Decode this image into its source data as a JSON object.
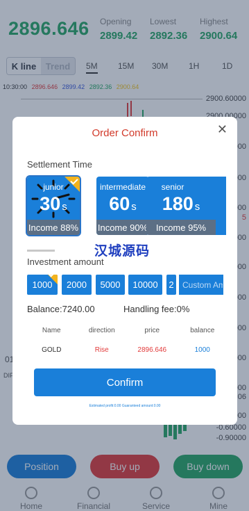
{
  "market": {
    "last_price": "2896.646",
    "stats": [
      {
        "label": "Opening",
        "value": "2899.42"
      },
      {
        "label": "Lowest",
        "value": "2892.36"
      },
      {
        "label": "Highest",
        "value": "2900.64"
      }
    ]
  },
  "chart_toolbar": {
    "kline_label": "K line",
    "trend_label": "Trend",
    "intervals": [
      "5M",
      "15M",
      "30M",
      "1H",
      "1D"
    ],
    "active_interval": "5M"
  },
  "ohlc": {
    "time": "10:30:00",
    "values": [
      "2896.646",
      "2899.42",
      "2892.36",
      "2900.64"
    ],
    "colors": [
      "#e23a3a",
      "#3b5bdb",
      "#27a865",
      "#f3c623"
    ]
  },
  "axis_labels": [
    "2900.60000",
    "2900.00000",
    "0000",
    "0000",
    "0000",
    "0000",
    "5",
    "0000",
    "0000",
    "0000",
    "0000",
    "0000",
    "06",
    "0.00000",
    "-0.60000",
    "-0.90000"
  ],
  "left_labels": {
    "time_fragment": "01",
    "dif": "DIF"
  },
  "actions": {
    "position": "Position",
    "buy_up": "Buy up",
    "buy_down": "Buy down"
  },
  "bottom_nav": [
    "Home",
    "Financial",
    "Service",
    "Mine"
  ],
  "modal": {
    "title": "Order Confirm",
    "settlement_label": "Settlement Time",
    "time_options": [
      {
        "name": "junior",
        "seconds": "30",
        "unit": "s",
        "income": "Income 88%"
      },
      {
        "name": "intermediate",
        "seconds": "60",
        "unit": "s",
        "income": "Income 90%"
      },
      {
        "name": "senior",
        "seconds": "180",
        "unit": "s",
        "income": "Income 95%"
      }
    ],
    "watermark": "汉城源码",
    "investment_label": "Investment amount",
    "amounts": [
      "1000",
      "2000",
      "5000",
      "10000",
      "2"
    ],
    "custom_placeholder": "Custom Amount",
    "balance": "Balance:7240.00",
    "fee": "Handling fee:0%",
    "table": {
      "headers": [
        "Name",
        "direction",
        "price",
        "balance"
      ],
      "row": [
        "GOLD",
        "Rise",
        "2896.646",
        "1000"
      ]
    },
    "confirm_label": "Confirm",
    "footnote": "Estimated profit:0.00   Guaranteed amount:0.00"
  },
  "colors": {
    "accent_blue": "#1a7fd9",
    "up_green": "#27a865",
    "rise_red": "#e23a3a",
    "badge_gold": "#f3b31d"
  }
}
